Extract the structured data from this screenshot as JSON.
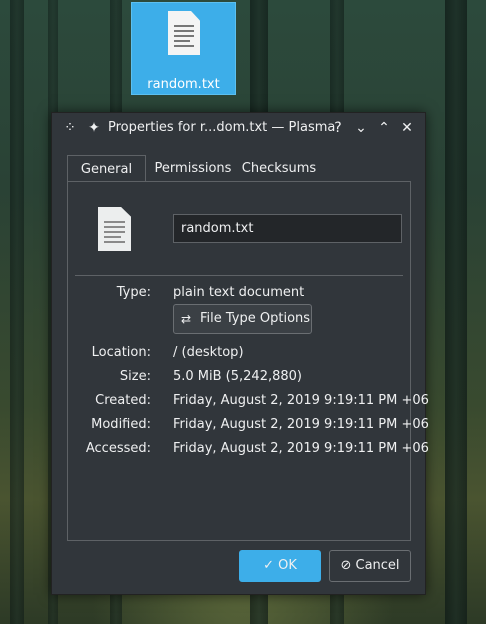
{
  "desktop": {
    "file_label": "random.txt"
  },
  "dialog": {
    "title": "Properties for r...dom.txt — Plasma",
    "icons": [
      "plasma-logo-icon",
      "pin-icon",
      "help-icon",
      "minimize-icon",
      "maximize-icon",
      "close-icon"
    ],
    "tabs": [
      "General",
      "Permissions",
      "Checksums"
    ],
    "active_tab": "General",
    "filename": "random.txt",
    "type_label": "Type:",
    "type_value": "plain text document",
    "file_type_options": "File Type Options",
    "location_label": "Location:",
    "location_value": "/ (desktop)",
    "size_label": "Size:",
    "size_value": "5.0 MiB (5,242,880)",
    "created_label": "Created:",
    "created_value": "Friday, August 2, 2019 9:19:11 PM +06",
    "modified_label": "Modified:",
    "modified_value": "Friday, August 2, 2019 9:19:11 PM +06",
    "accessed_label": "Accessed:",
    "accessed_value": "Friday, August 2, 2019 9:19:11 PM +06",
    "ok_label": "OK",
    "cancel_label": "Cancel"
  },
  "colors": {
    "accent": "#3daee9",
    "dialog_bg": "#31363b",
    "text": "#eff0f1"
  }
}
